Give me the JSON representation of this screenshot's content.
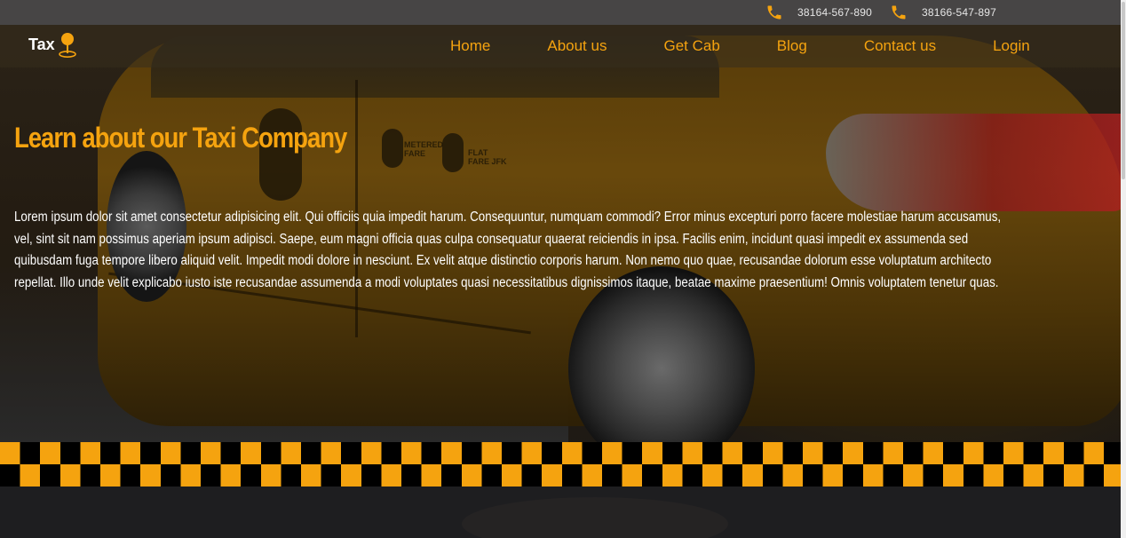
{
  "topbar": {
    "phones": [
      {
        "icon": "phone-icon",
        "number": "38164-567-890"
      },
      {
        "icon": "phone-icon",
        "number": "38166-547-897"
      }
    ]
  },
  "brand": {
    "name": "Tax",
    "icon": "map-pin-icon"
  },
  "nav": {
    "items": [
      {
        "label": "Home"
      },
      {
        "label": "About us"
      },
      {
        "label": "Get Cab"
      },
      {
        "label": "Blog"
      },
      {
        "label": "Contact us"
      },
      {
        "label": "Login"
      }
    ]
  },
  "hero": {
    "title": "Learn about our Taxi Company",
    "body": "Lorem ipsum dolor sit amet consectetur adipisicing elit. Qui officiis quia impedit harum. Consequuntur, numquam commodi? Error minus excepturi porro facere molestiae harum accusamus, vel, sint sit nam possimus aperiam ipsum adipisci. Saepe, eum magni officia quas culpa consequatur quaerat reiciendis in ipsa. Facilis enim, incidunt quasi impedit ex assumenda sed quibusdam fuga tempore libero aliquid velit. Impedit modi dolore in nesciunt. Ex velit atque distinctio corporis harum. Non nemo quo quae, recusandae dolorum esse voluptatum architecto repellat. Illo unde velit explicabo iusto iste recusandae assumenda a modi voluptates quasi necessitatibus dignissimos itaque, beatae maxime praesentium! Omnis voluptatem tenetur quas.",
    "car_badges": [
      "METERED FARE",
      "FLAT FARE JFK"
    ]
  },
  "colors": {
    "accent": "#f5a30f",
    "topbar_bg": "#474545",
    "text": "#ffffff"
  }
}
